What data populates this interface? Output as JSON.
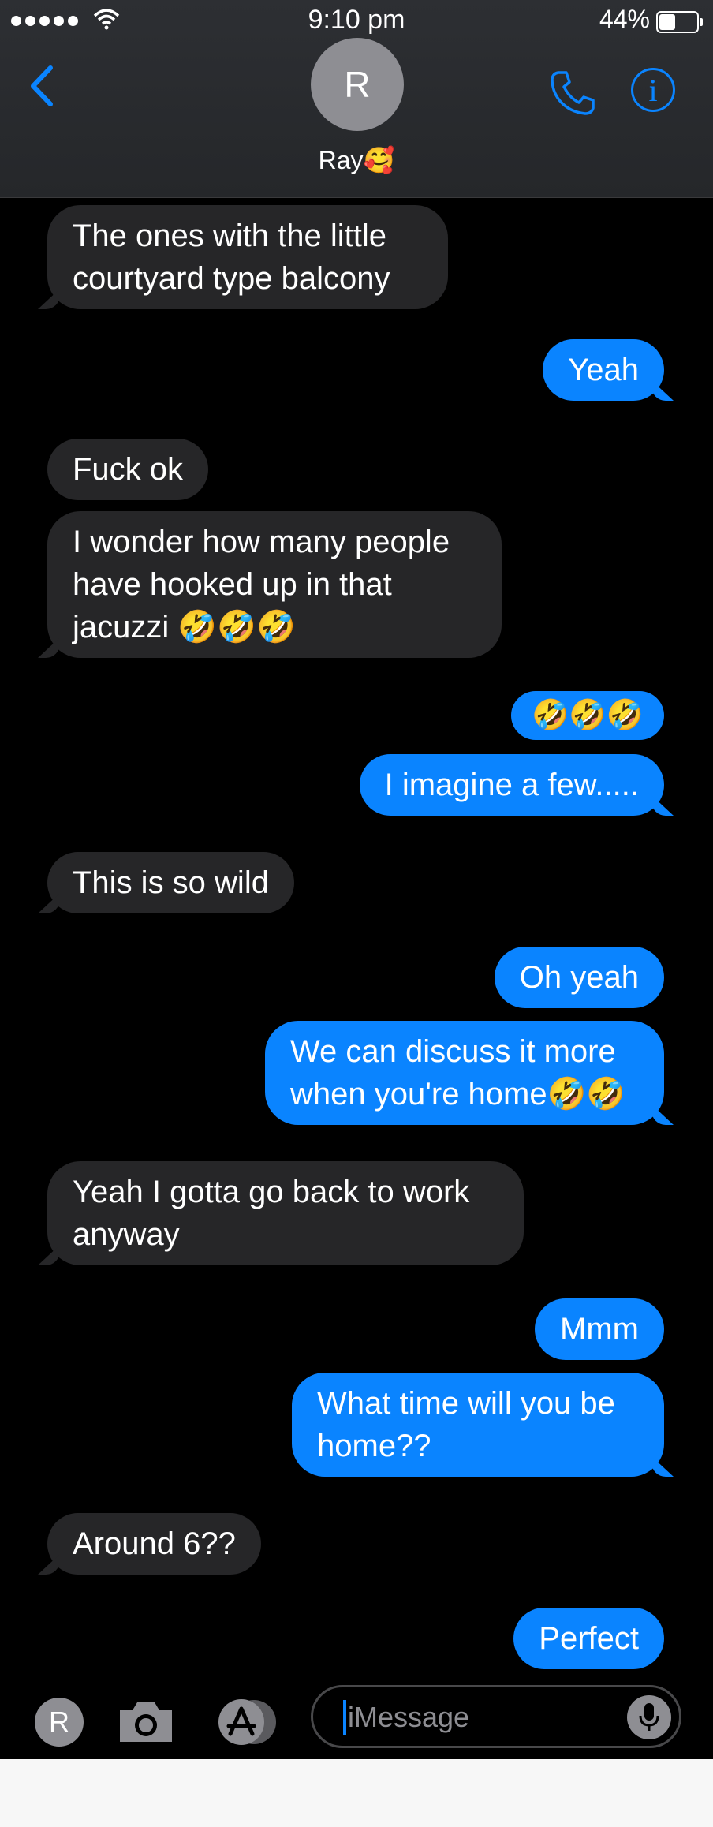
{
  "status_bar": {
    "time": "9:10 pm",
    "battery": "44%",
    "battery_level": 0.44
  },
  "header": {
    "avatar_initial": "R",
    "contact_name": "Ray🥰"
  },
  "messages": [
    {
      "side": "in",
      "text": "The ones with the little courtyard type balcony"
    },
    {
      "side": "out",
      "text": "Yeah"
    },
    {
      "side": "in",
      "text": "Fuck ok"
    },
    {
      "side": "in",
      "text": "I wonder how many people have hooked up in that jacuzzi 🤣🤣🤣"
    },
    {
      "side": "out",
      "text": "🤣🤣🤣"
    },
    {
      "side": "out",
      "text": "I imagine a few....."
    },
    {
      "side": "in",
      "text": "This is so wild"
    },
    {
      "side": "out",
      "text": "Oh yeah"
    },
    {
      "side": "out",
      "text": "We can discuss it more when you're home🤣🤣"
    },
    {
      "side": "in",
      "text": "Yeah I gotta go back to work anyway"
    },
    {
      "side": "out",
      "text": "Mmm"
    },
    {
      "side": "out",
      "text": "What time will you be home??"
    },
    {
      "side": "in",
      "text": "Around 6??"
    },
    {
      "side": "out",
      "text": "Perfect"
    }
  ],
  "input_bar": {
    "avatar_initial": "R",
    "placeholder": "iMessage"
  },
  "icons": [
    "back-icon",
    "phone-icon",
    "info-icon",
    "camera-icon",
    "app-store-icon",
    "microphone-icon"
  ],
  "colors": {
    "accent": "#0a84ff",
    "incoming_bubble": "#262628",
    "outgoing_bubble": "#0a84ff",
    "background": "#000000"
  }
}
